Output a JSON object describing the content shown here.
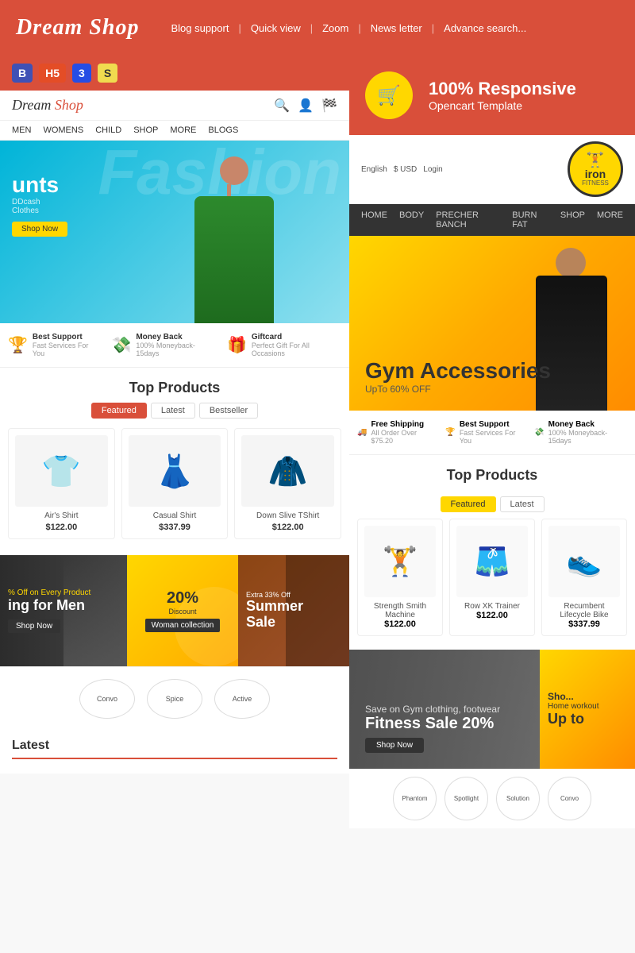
{
  "header": {
    "logo": "Dream Shop",
    "nav": {
      "items": [
        {
          "label": "Blog support"
        },
        {
          "label": "Quick view"
        },
        {
          "label": "Zoom"
        },
        {
          "label": "News letter"
        },
        {
          "label": "Advance search..."
        }
      ]
    }
  },
  "left": {
    "badges": [
      "B",
      "H5",
      "3",
      "S"
    ],
    "inner_header": {
      "logo": "Dream Shop"
    },
    "inner_nav": [
      "MEN",
      "WOMENS",
      "CHILD",
      "SHOP",
      "MORE",
      "BLOGS"
    ],
    "hero": {
      "discount": "unts",
      "brand": "DDcash",
      "sub": "Clothes",
      "btn": "Shop Now",
      "fashion_text": "Fashion"
    },
    "features": [
      {
        "icon": "🏆",
        "title": "Best Support",
        "sub": "Fast Services For You"
      },
      {
        "icon": "💸",
        "title": "Money Back",
        "sub": "100% Moneyback-15days"
      },
      {
        "icon": "🎁",
        "title": "Giftcard",
        "sub": "Perfect Gift For All Occasions"
      }
    ],
    "top_products": {
      "title": "Top Products",
      "tabs": [
        "Featured",
        "Latest",
        "Bestseller"
      ],
      "products": [
        {
          "name": "Air's Shirt",
          "price": "$122.00",
          "emoji": "👕"
        },
        {
          "name": "Casual Shirt",
          "price": "$337.99",
          "emoji": "👗"
        },
        {
          "name": "Down Slive TShirt",
          "price": "$122.00",
          "emoji": "🧥"
        }
      ]
    },
    "promo": {
      "men": {
        "off": "% Off on Every Product",
        "title": "ing for Men",
        "btn": "Shop Now"
      },
      "women": {
        "pct": "20%",
        "label": "Discount",
        "collection": "Woman collection"
      },
      "summer": {
        "extra": "Extra 33% Off",
        "title": "Summer\nSale"
      }
    },
    "brands": [
      "Convo",
      "Spice",
      "Active"
    ],
    "latest_title": "Latest"
  },
  "right": {
    "responsive": {
      "pct": "100% Responsive",
      "sub": "Opencart Template",
      "cart_icon": "🛒"
    },
    "iron": {
      "logo_text": "iron",
      "logo_sub": "FITNESS",
      "lang": "English",
      "currency": "$ USD",
      "login": "Login",
      "nav": [
        "HOME",
        "BODY",
        "PRECHER BANCH",
        "BURN FAT",
        "SHOP",
        "MORE"
      ]
    },
    "gym_hero": {
      "title": "Gym Accessories",
      "upto": "UpTo 60% OFF"
    },
    "gym_features": [
      {
        "icon": "🚚",
        "title": "Free Shipping",
        "sub": "All Order Over $75.20"
      },
      {
        "icon": "🏆",
        "title": "Best Support",
        "sub": "Fast Services For You"
      },
      {
        "icon": "💸",
        "title": "Money Back",
        "sub": "100% Moneyback-15days"
      }
    ],
    "top_products": {
      "title": "Top Products",
      "tabs": [
        "Featured",
        "Latest"
      ],
      "products": [
        {
          "name": "Strength Smith Machine",
          "price": "$122.00",
          "emoji": "🏋️"
        },
        {
          "name": "Row XK Trainer",
          "price": "$122.00",
          "emoji": "🩳"
        },
        {
          "name": "Recumbent Lifecycle Bike",
          "price": "$337.99",
          "emoji": "👟"
        }
      ]
    },
    "fitness_sale": {
      "save": "Save on Gym clothing, footwear",
      "title": "Fitness Sale 20%",
      "btn": "Shop Now",
      "side": "Sho...",
      "side_sub": "Home workout",
      "upto": "Up to"
    },
    "brands": [
      "Phantom",
      "Spotlight",
      "Solution",
      "Convo"
    ]
  }
}
